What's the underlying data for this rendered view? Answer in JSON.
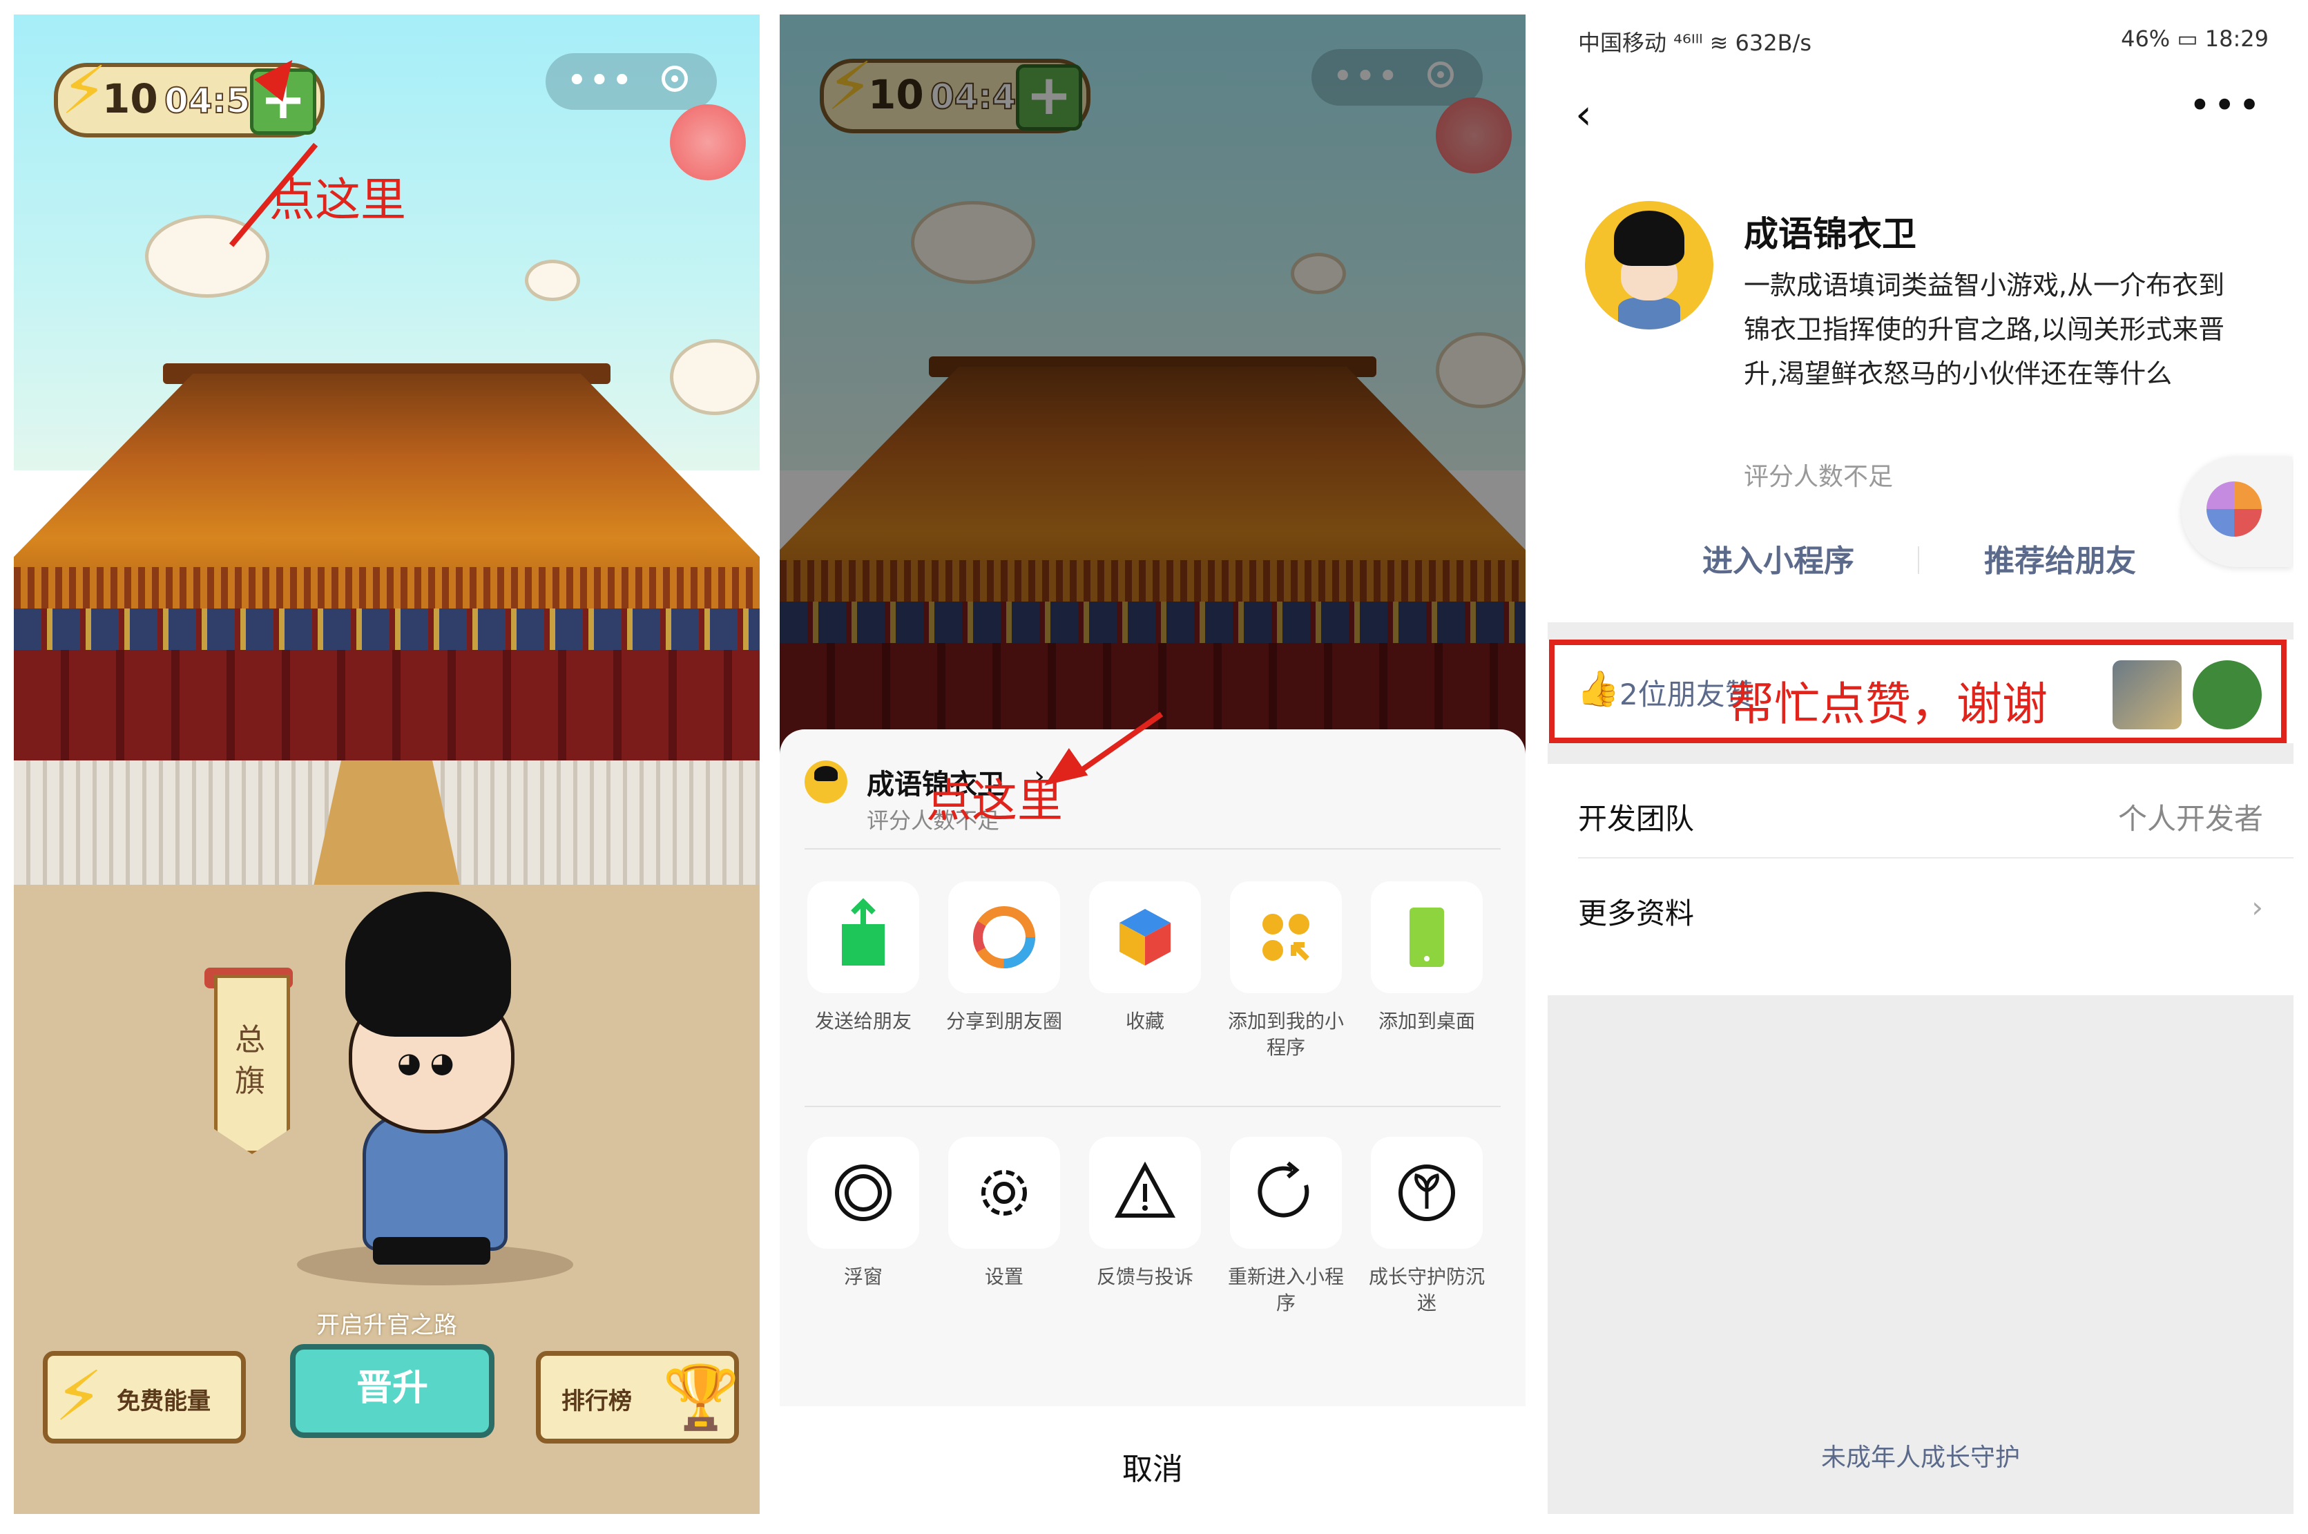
{
  "colors": {
    "annotation_red": "#e0231b",
    "link_blue": "#5b6a8a",
    "teal_button": "#58d6c8"
  },
  "panel1": {
    "timer_hundred": "10",
    "timer_clock": "04:53",
    "scroll_text": "总旗",
    "start_road": "开启升官之路",
    "btn_free_energy": "免费能量",
    "btn_promote": "晋升",
    "btn_rank": "排行榜",
    "annotation": "点这里"
  },
  "panel2": {
    "timer_hundred": "10",
    "timer_clock": "04:43",
    "sheet_title": "成语锦衣卫",
    "sheet_sub": "评分人数不足",
    "annotation": "点这里",
    "row1": [
      {
        "label": "发送给朋友",
        "icon": "share-to-friend-icon"
      },
      {
        "label": "分享到朋友圈",
        "icon": "moments-icon"
      },
      {
        "label": "收藏",
        "icon": "favorite-cube-icon"
      },
      {
        "label": "添加到我的小程序",
        "icon": "add-mini-program-icon"
      },
      {
        "label": "添加到桌面",
        "icon": "add-to-desktop-icon"
      }
    ],
    "row2": [
      {
        "label": "浮窗",
        "icon": "float-window-icon"
      },
      {
        "label": "设置",
        "icon": "settings-gear-icon"
      },
      {
        "label": "反馈与投诉",
        "icon": "warning-icon"
      },
      {
        "label": "重新进入小程序",
        "icon": "reload-icon"
      },
      {
        "label": "成长守护防沉迷",
        "icon": "sprout-icon"
      }
    ],
    "cancel": "取消"
  },
  "panel3": {
    "status_left": "中国移动 ⁴⁶ᴵˡˡ ≋ 632B/s",
    "status_right": "46% ▭ 18:29",
    "title": "成语锦衣卫",
    "description": "一款成语填词类益智小游戏,从一介布衣到锦衣卫指挥使的升官之路,以闯关形式来晋升,渴望鲜衣怒马的小伙伴还在等什么",
    "rating": "评分人数不足",
    "enter": "进入小程序",
    "recommend": "推荐给朋友",
    "likes": "2位朋友赞",
    "red_note": "帮忙点赞，谢谢",
    "dev_team_key": "开发团队",
    "dev_team_val": "个人开发者",
    "more_info": "更多资料",
    "footer": "未成年人成长守护"
  }
}
